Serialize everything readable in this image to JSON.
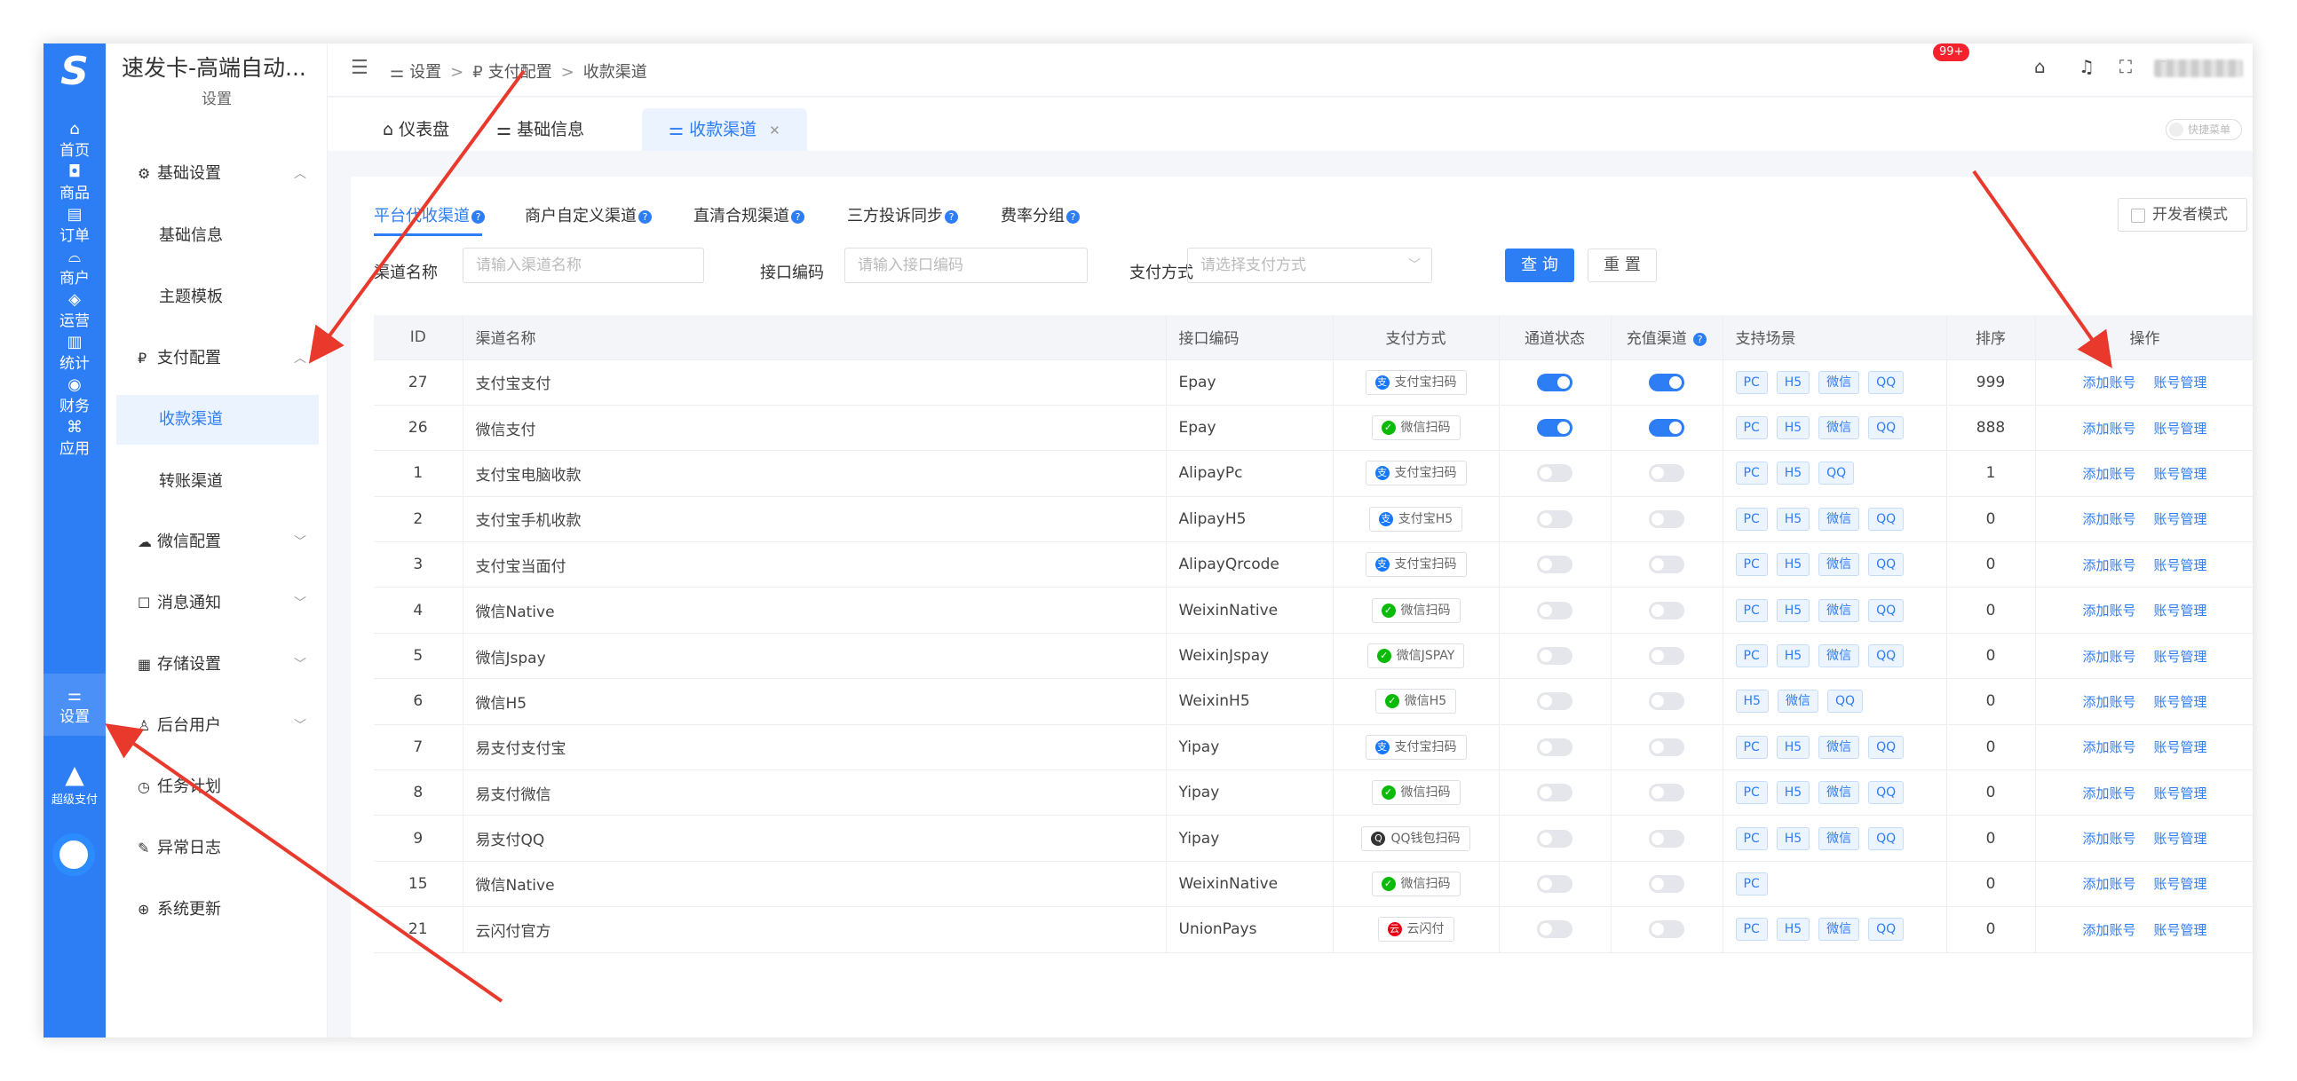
{
  "app": {
    "title": "速发卡-高端自动...",
    "logo_letter": "S"
  },
  "rail": [
    {
      "label": "首页",
      "icon": "home-icon"
    },
    {
      "label": "商品",
      "icon": "goods-icon"
    },
    {
      "label": "订单",
      "icon": "order-icon"
    },
    {
      "label": "商户",
      "icon": "shop-icon"
    },
    {
      "label": "运营",
      "icon": "layers-icon"
    },
    {
      "label": "统计",
      "icon": "stats-icon"
    },
    {
      "label": "财务",
      "icon": "finance-icon"
    },
    {
      "label": "应用",
      "icon": "apps-icon"
    },
    {
      "label": "设置",
      "icon": "settings-icon"
    }
  ],
  "rail_extra": {
    "label": "超级支付"
  },
  "submenu": {
    "header": "设置",
    "items": [
      {
        "label": "基础设置",
        "expanded": true
      },
      {
        "label": "基础信息"
      },
      {
        "label": "主题模板"
      },
      {
        "label": "支付配置",
        "expanded": true
      },
      {
        "label": "收款渠道",
        "active": true
      },
      {
        "label": "转账渠道"
      },
      {
        "label": "微信配置"
      },
      {
        "label": "消息通知"
      },
      {
        "label": "存储设置"
      },
      {
        "label": "后台用户"
      },
      {
        "label": "任务计划"
      },
      {
        "label": "异常日志"
      },
      {
        "label": "系统更新"
      }
    ]
  },
  "breadcrumb": [
    "设置",
    "支付配置",
    "收款渠道"
  ],
  "topbar": {
    "notifications_badge": "99+"
  },
  "tabs": [
    "仪表盘",
    "基础信息",
    "收款渠道"
  ],
  "quick_menu_label": "快捷菜单",
  "channel_tabs": [
    {
      "label": "平台代收渠道",
      "active": true
    },
    {
      "label": "商户自定义渠道"
    },
    {
      "label": "直清合规渠道"
    },
    {
      "label": "三方投诉同步"
    },
    {
      "label": "费率分组"
    }
  ],
  "dev_mode_label": "开发者模式",
  "filters": {
    "name_label": "渠道名称",
    "name_placeholder": "请输入渠道名称",
    "code_label": "接口编码",
    "code_placeholder": "请输入接口编码",
    "method_label": "支付方式",
    "method_placeholder": "请选择支付方式",
    "query_button": "查 询",
    "reset_button": "重 置"
  },
  "table": {
    "columns": [
      "ID",
      "渠道名称",
      "接口编码",
      "支付方式",
      "通道状态",
      "充值渠道",
      "支持场景",
      "排序",
      "操作"
    ],
    "action_add": "添加账号",
    "action_manage": "账号管理",
    "rows": [
      {
        "id": "27",
        "name": "支付宝支付",
        "code": "Epay",
        "method": "支付宝扫码",
        "method_type": "alipay",
        "status": true,
        "recharge": true,
        "scenes": [
          "PC",
          "H5",
          "微信",
          "QQ"
        ],
        "sort": "999"
      },
      {
        "id": "26",
        "name": "微信支付",
        "code": "Epay",
        "method": "微信扫码",
        "method_type": "wechat",
        "status": true,
        "recharge": true,
        "scenes": [
          "PC",
          "H5",
          "微信",
          "QQ"
        ],
        "sort": "888"
      },
      {
        "id": "1",
        "name": "支付宝电脑收款",
        "code": "AlipayPc",
        "method": "支付宝扫码",
        "method_type": "alipay",
        "status": false,
        "recharge": false,
        "scenes": [
          "PC",
          "H5",
          "QQ"
        ],
        "sort": "1"
      },
      {
        "id": "2",
        "name": "支付宝手机收款",
        "code": "AlipayH5",
        "method": "支付宝H5",
        "method_type": "alipay",
        "status": false,
        "recharge": false,
        "scenes": [
          "PC",
          "H5",
          "微信",
          "QQ"
        ],
        "sort": "0"
      },
      {
        "id": "3",
        "name": "支付宝当面付",
        "code": "AlipayQrcode",
        "method": "支付宝扫码",
        "method_type": "alipay",
        "status": false,
        "recharge": false,
        "scenes": [
          "PC",
          "H5",
          "微信",
          "QQ"
        ],
        "sort": "0"
      },
      {
        "id": "4",
        "name": "微信Native",
        "code": "WeixinNative",
        "method": "微信扫码",
        "method_type": "wechat",
        "status": false,
        "recharge": false,
        "scenes": [
          "PC",
          "H5",
          "微信",
          "QQ"
        ],
        "sort": "0"
      },
      {
        "id": "5",
        "name": "微信Jspay",
        "code": "WeixinJspay",
        "method": "微信JSPAY",
        "method_type": "wechat",
        "status": false,
        "recharge": false,
        "scenes": [
          "PC",
          "H5",
          "微信",
          "QQ"
        ],
        "sort": "0"
      },
      {
        "id": "6",
        "name": "微信H5",
        "code": "WeixinH5",
        "method": "微信H5",
        "method_type": "wechat",
        "status": false,
        "recharge": false,
        "scenes": [
          "H5",
          "微信",
          "QQ"
        ],
        "sort": "0"
      },
      {
        "id": "7",
        "name": "易支付支付宝",
        "code": "Yipay",
        "method": "支付宝扫码",
        "method_type": "alipay",
        "status": false,
        "recharge": false,
        "scenes": [
          "PC",
          "H5",
          "微信",
          "QQ"
        ],
        "sort": "0"
      },
      {
        "id": "8",
        "name": "易支付微信",
        "code": "Yipay",
        "method": "微信扫码",
        "method_type": "wechat",
        "status": false,
        "recharge": false,
        "scenes": [
          "PC",
          "H5",
          "微信",
          "QQ"
        ],
        "sort": "0"
      },
      {
        "id": "9",
        "name": "易支付QQ",
        "code": "Yipay",
        "method": "QQ钱包扫码",
        "method_type": "qq",
        "status": false,
        "recharge": false,
        "scenes": [
          "PC",
          "H5",
          "微信",
          "QQ"
        ],
        "sort": "0"
      },
      {
        "id": "15",
        "name": "微信Native",
        "code": "WeixinNative",
        "method": "微信扫码",
        "method_type": "wechat",
        "status": false,
        "recharge": false,
        "scenes": [
          "PC"
        ],
        "sort": "0"
      },
      {
        "id": "21",
        "name": "云闪付官方",
        "code": "UnionPays",
        "method": "云闪付",
        "method_type": "union",
        "status": false,
        "recharge": false,
        "scenes": [
          "PC",
          "H5",
          "微信",
          "QQ"
        ],
        "sort": "0"
      }
    ]
  },
  "colors": {
    "primary": "#2d7df5",
    "annotation_arrow": "#e8392c"
  }
}
